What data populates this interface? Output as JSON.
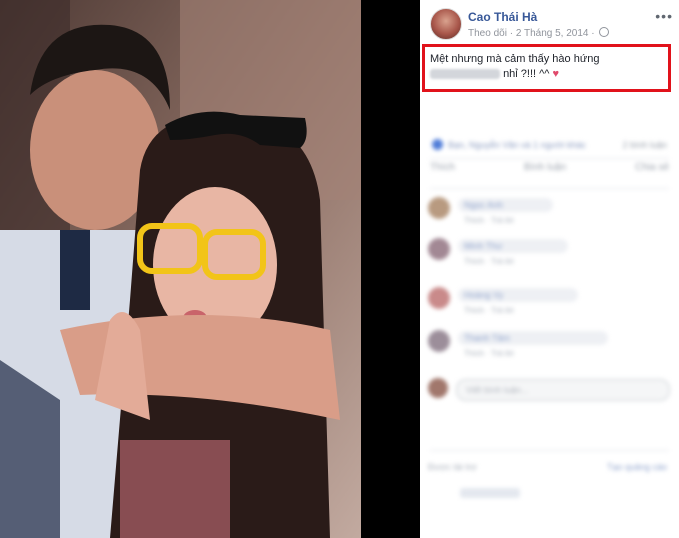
{
  "post": {
    "author": "Cao Thái Hà",
    "follow": "Theo dõi",
    "separator": "·",
    "date": "2 Tháng 5, 2014",
    "more_icon": "more-horizontal-icon",
    "status_part1": "Mệt nhưng mà cảm thấy hào hứng",
    "status_part2": "nhỉ ?!!! ^^",
    "heart": "♥",
    "highlight_color": "#e1121b"
  },
  "photo": {
    "description_icon": "photo"
  },
  "blurred": {
    "reaction_text": "Bạn, Nguyễn Văn và 1 người khác",
    "reaction_count": "2 bình luận",
    "actions": [
      "Thích",
      "Bình luận",
      "Chia sẻ"
    ],
    "comments": [
      {
        "name": "Ngọc Anh",
        "sub": "Thích · Trả lời"
      },
      {
        "name": "Minh Thư",
        "sub": "Thích · Trả lời"
      },
      {
        "name": "Hoàng Vy",
        "sub": "Thích · Trả lời"
      },
      {
        "name": "Thanh Tâm",
        "sub": "Thích · Trả lời"
      }
    ],
    "write_placeholder": "Viết bình luận...",
    "sponsored_left": "Được tài trợ",
    "sponsored_right": "Tạo quảng cáo"
  }
}
